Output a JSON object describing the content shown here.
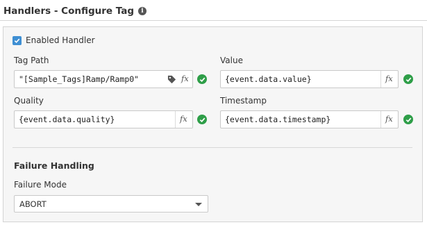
{
  "header": {
    "title": "Handlers - Configure Tag",
    "info_icon": "info-circle-icon"
  },
  "handler": {
    "enabled_label": "Enabled Handler",
    "enabled": true
  },
  "fields": {
    "tag_path": {
      "label": "Tag Path",
      "value": "\"[Sample_Tags]Ramp/Ramp0\""
    },
    "value": {
      "label": "Value",
      "value": "{event.data.value}"
    },
    "quality": {
      "label": "Quality",
      "value": "{event.data.quality}"
    },
    "timestamp": {
      "label": "Timestamp",
      "value": "{event.data.timestamp}"
    }
  },
  "icons": {
    "expression": "fx",
    "tag_browse": "tag-icon",
    "valid": "check-circle-icon"
  },
  "colors": {
    "valid": "#2e9e48",
    "checkbox": "#3f8fd3"
  },
  "failure": {
    "section_title": "Failure Handling",
    "mode_label": "Failure Mode",
    "mode_value": "ABORT"
  }
}
